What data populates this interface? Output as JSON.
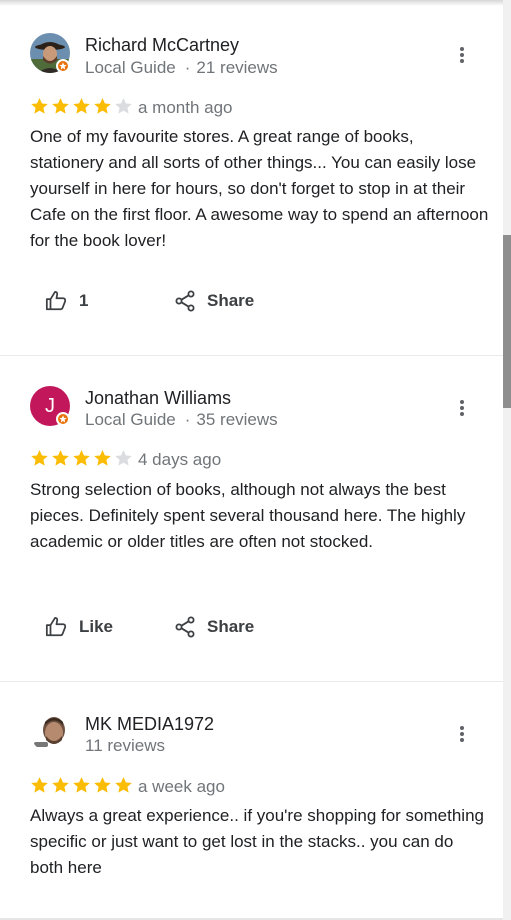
{
  "colors": {
    "star_filled": "#fbbc04",
    "star_empty": "#dadce0",
    "guide_badge": "#e8710a",
    "avatar_j": "#c2185b"
  },
  "reviews": [
    {
      "author": "Richard McCartney",
      "meta_role": "Local Guide",
      "meta_reviews": "21 reviews",
      "rating": 4,
      "time": "a month ago",
      "text": "One of my favourite stores. A great range of books, stationery and all sorts of other things... You can easily lose yourself in here for hours, so don't forget to stop in at their Cafe on the first floor. A awesome way to spend an afternoon for the book lover!",
      "like_label": "1",
      "share_label": "Share"
    },
    {
      "author": "Jonathan Williams",
      "avatar_letter": "J",
      "meta_role": "Local Guide",
      "meta_reviews": "35 reviews",
      "rating": 4,
      "time": "4 days ago",
      "text": "Strong selection of books, although not always the best pieces. Definitely spent several thousand here. The highly academic or older titles are often not stocked.",
      "like_label": "Like",
      "share_label": "Share"
    },
    {
      "author": "MK MEDIA1972",
      "meta_reviews": "11 reviews",
      "rating": 5,
      "time": "a week ago",
      "text": "Always a great experience.. if you're shopping for something specific or just want to get lost in the stacks.. you can do both here"
    }
  ]
}
